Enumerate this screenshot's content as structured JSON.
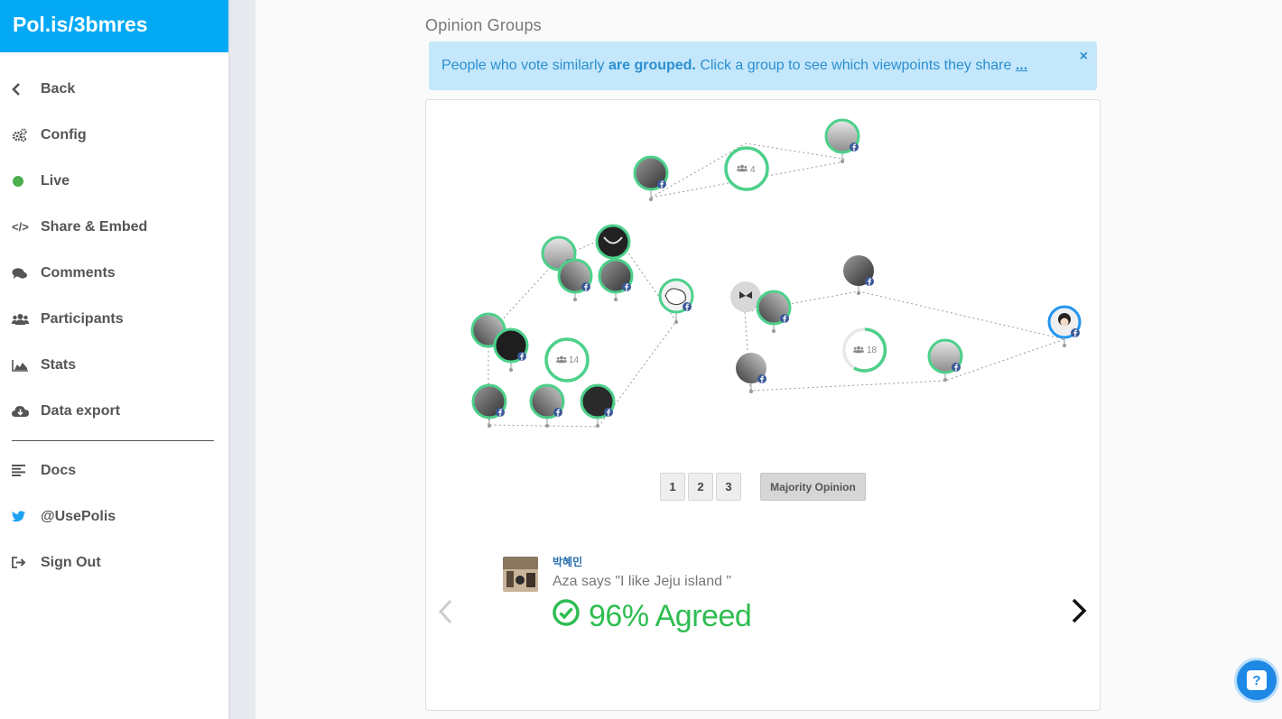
{
  "brand": "Pol.is/3bmres",
  "nav": {
    "back": "Back",
    "config": "Config",
    "live": "Live",
    "share": "Share & Embed",
    "comments": "Comments",
    "participants": "Participants",
    "stats": "Stats",
    "export": "Data export",
    "docs": "Docs",
    "twitter": "@UsePolis",
    "signout": "Sign Out"
  },
  "section_title": "Opinion Groups",
  "alert": {
    "text_before": "People who vote similarly ",
    "bold": "are grouped.",
    "text_after": " Click a group to see which viewpoints they share ",
    "more": "...",
    "close": "×"
  },
  "groups": [
    {
      "count": "4"
    },
    {
      "count": "14"
    },
    {
      "count": "18"
    }
  ],
  "pager": {
    "p1": "1",
    "p2": "2",
    "p3": "3",
    "majority": "Majority Opinion"
  },
  "comment": {
    "author": "박혜민",
    "text": "Aza says \"I like Jeju island \"",
    "agreed": "96% Agreed"
  },
  "colors": {
    "brand": "#03a9f4",
    "group_ring": "#4cd08a",
    "agree": "#2ebd51",
    "alert_bg": "#c5e7fb"
  }
}
